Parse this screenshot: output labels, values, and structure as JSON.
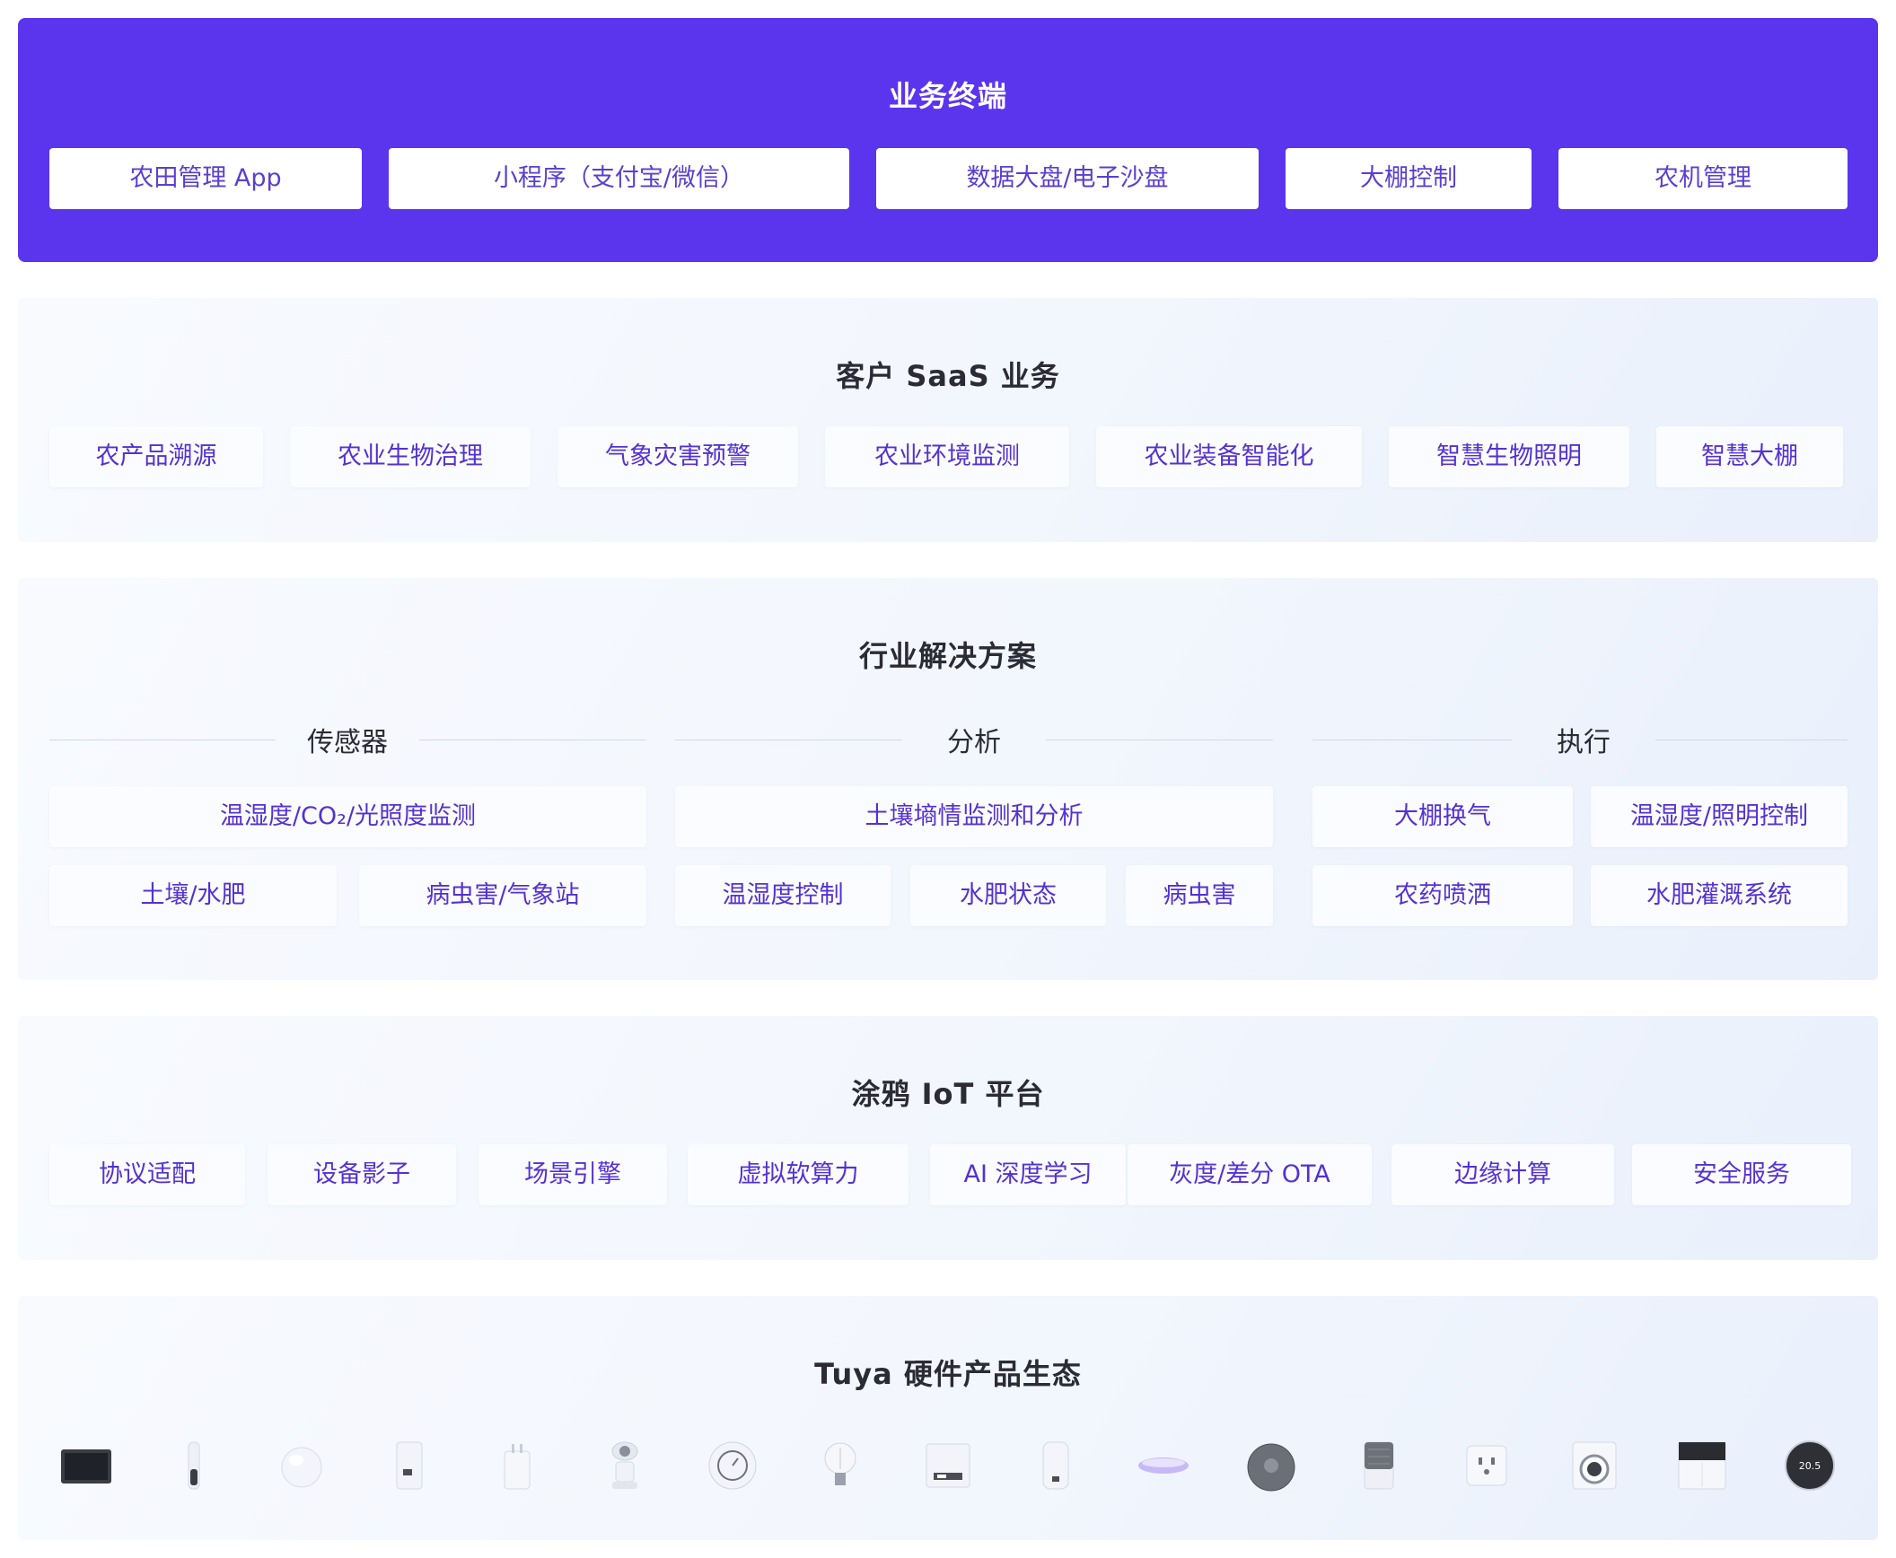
{
  "terminal": {
    "title": "业务终端",
    "items": [
      "农田管理 App",
      "小程序（支付宝/微信）",
      "数据大盘/电子沙盘",
      "大棚控制",
      "农机管理"
    ]
  },
  "saas": {
    "title": "客户 SaaS 业务",
    "items": [
      "农产品溯源",
      "农业生物治理",
      "气象灾害预警",
      "农业环境监测",
      "农业装备智能化",
      "智慧生物照明",
      "智慧大棚"
    ]
  },
  "solution": {
    "title": "行业解决方案",
    "groups": [
      {
        "title": "传感器",
        "row1": [
          "温湿度/CO₂/光照度监测"
        ],
        "row2": [
          "土壤/水肥",
          "病虫害/气象站"
        ]
      },
      {
        "title": "分析",
        "row1": [
          "土壤墒情监测和分析"
        ],
        "row2": [
          "温湿度控制",
          "水肥状态",
          "病虫害"
        ]
      },
      {
        "title": "执行",
        "row1": [
          "大棚换气",
          "温湿度/照明控制"
        ],
        "row2": [
          "农药喷洒",
          "水肥灌溉系统"
        ]
      }
    ]
  },
  "iot": {
    "title": "涂鸦 IoT 平台",
    "items": [
      "协议适配",
      "设备影子",
      "场景引擎",
      "虚拟软算力",
      "AI 深度学习",
      "灰度/差分 OTA",
      "边缘计算",
      "安全服务"
    ]
  },
  "hardware": {
    "title": "Tuya 硬件产品生态",
    "thermostat_reading": "20.5",
    "devices": [
      "tablet-icon",
      "sensor-stick-icon",
      "smart-ball-icon",
      "water-heater-icon",
      "smart-plug-icon",
      "camera-icon",
      "gauge-icon",
      "light-bulb-icon",
      "gateway-icon",
      "humidifier-icon",
      "ceiling-light-icon",
      "robot-vacuum-icon",
      "air-purifier-icon",
      "wall-socket-icon",
      "washing-machine-icon",
      "switch-panel-icon",
      "thermostat-icon"
    ]
  },
  "colors": {
    "accent": "#5b35ee",
    "pill_text": "#5432d3",
    "title": "#2b2b35"
  }
}
